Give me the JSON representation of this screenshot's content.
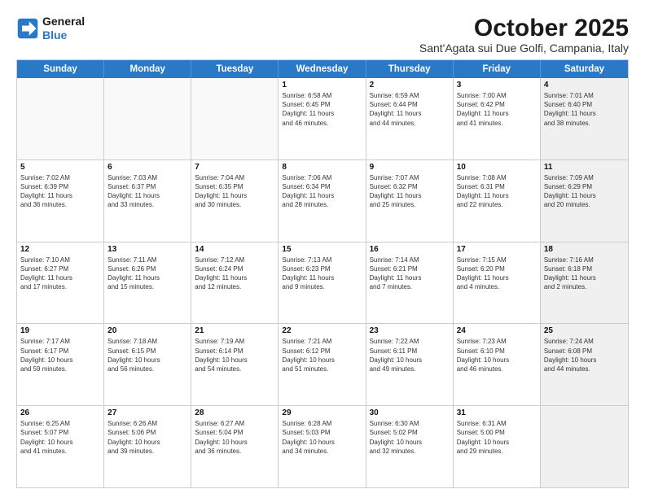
{
  "logo": {
    "line1": "General",
    "line2": "Blue"
  },
  "title": "October 2025",
  "subtitle": "Sant'Agata sui Due Golfi, Campania, Italy",
  "days": [
    "Sunday",
    "Monday",
    "Tuesday",
    "Wednesday",
    "Thursday",
    "Friday",
    "Saturday"
  ],
  "rows": [
    [
      {
        "day": "",
        "text": "",
        "empty": true
      },
      {
        "day": "",
        "text": "",
        "empty": true
      },
      {
        "day": "",
        "text": "",
        "empty": true
      },
      {
        "day": "1",
        "text": "Sunrise: 6:58 AM\nSunset: 6:45 PM\nDaylight: 11 hours\nand 46 minutes."
      },
      {
        "day": "2",
        "text": "Sunrise: 6:59 AM\nSunset: 6:44 PM\nDaylight: 11 hours\nand 44 minutes."
      },
      {
        "day": "3",
        "text": "Sunrise: 7:00 AM\nSunset: 6:42 PM\nDaylight: 11 hours\nand 41 minutes."
      },
      {
        "day": "4",
        "text": "Sunrise: 7:01 AM\nSunset: 6:40 PM\nDaylight: 11 hours\nand 38 minutes.",
        "shaded": true
      }
    ],
    [
      {
        "day": "5",
        "text": "Sunrise: 7:02 AM\nSunset: 6:39 PM\nDaylight: 11 hours\nand 36 minutes."
      },
      {
        "day": "6",
        "text": "Sunrise: 7:03 AM\nSunset: 6:37 PM\nDaylight: 11 hours\nand 33 minutes."
      },
      {
        "day": "7",
        "text": "Sunrise: 7:04 AM\nSunset: 6:35 PM\nDaylight: 11 hours\nand 30 minutes."
      },
      {
        "day": "8",
        "text": "Sunrise: 7:06 AM\nSunset: 6:34 PM\nDaylight: 11 hours\nand 28 minutes."
      },
      {
        "day": "9",
        "text": "Sunrise: 7:07 AM\nSunset: 6:32 PM\nDaylight: 11 hours\nand 25 minutes."
      },
      {
        "day": "10",
        "text": "Sunrise: 7:08 AM\nSunset: 6:31 PM\nDaylight: 11 hours\nand 22 minutes."
      },
      {
        "day": "11",
        "text": "Sunrise: 7:09 AM\nSunset: 6:29 PM\nDaylight: 11 hours\nand 20 minutes.",
        "shaded": true
      }
    ],
    [
      {
        "day": "12",
        "text": "Sunrise: 7:10 AM\nSunset: 6:27 PM\nDaylight: 11 hours\nand 17 minutes."
      },
      {
        "day": "13",
        "text": "Sunrise: 7:11 AM\nSunset: 6:26 PM\nDaylight: 11 hours\nand 15 minutes."
      },
      {
        "day": "14",
        "text": "Sunrise: 7:12 AM\nSunset: 6:24 PM\nDaylight: 11 hours\nand 12 minutes."
      },
      {
        "day": "15",
        "text": "Sunrise: 7:13 AM\nSunset: 6:23 PM\nDaylight: 11 hours\nand 9 minutes."
      },
      {
        "day": "16",
        "text": "Sunrise: 7:14 AM\nSunset: 6:21 PM\nDaylight: 11 hours\nand 7 minutes."
      },
      {
        "day": "17",
        "text": "Sunrise: 7:15 AM\nSunset: 6:20 PM\nDaylight: 11 hours\nand 4 minutes."
      },
      {
        "day": "18",
        "text": "Sunrise: 7:16 AM\nSunset: 6:18 PM\nDaylight: 11 hours\nand 2 minutes.",
        "shaded": true
      }
    ],
    [
      {
        "day": "19",
        "text": "Sunrise: 7:17 AM\nSunset: 6:17 PM\nDaylight: 10 hours\nand 59 minutes."
      },
      {
        "day": "20",
        "text": "Sunrise: 7:18 AM\nSunset: 6:15 PM\nDaylight: 10 hours\nand 56 minutes."
      },
      {
        "day": "21",
        "text": "Sunrise: 7:19 AM\nSunset: 6:14 PM\nDaylight: 10 hours\nand 54 minutes."
      },
      {
        "day": "22",
        "text": "Sunrise: 7:21 AM\nSunset: 6:12 PM\nDaylight: 10 hours\nand 51 minutes."
      },
      {
        "day": "23",
        "text": "Sunrise: 7:22 AM\nSunset: 6:11 PM\nDaylight: 10 hours\nand 49 minutes."
      },
      {
        "day": "24",
        "text": "Sunrise: 7:23 AM\nSunset: 6:10 PM\nDaylight: 10 hours\nand 46 minutes."
      },
      {
        "day": "25",
        "text": "Sunrise: 7:24 AM\nSunset: 6:08 PM\nDaylight: 10 hours\nand 44 minutes.",
        "shaded": true
      }
    ],
    [
      {
        "day": "26",
        "text": "Sunrise: 6:25 AM\nSunset: 5:07 PM\nDaylight: 10 hours\nand 41 minutes."
      },
      {
        "day": "27",
        "text": "Sunrise: 6:26 AM\nSunset: 5:06 PM\nDaylight: 10 hours\nand 39 minutes."
      },
      {
        "day": "28",
        "text": "Sunrise: 6:27 AM\nSunset: 5:04 PM\nDaylight: 10 hours\nand 36 minutes."
      },
      {
        "day": "29",
        "text": "Sunrise: 6:28 AM\nSunset: 5:03 PM\nDaylight: 10 hours\nand 34 minutes."
      },
      {
        "day": "30",
        "text": "Sunrise: 6:30 AM\nSunset: 5:02 PM\nDaylight: 10 hours\nand 32 minutes."
      },
      {
        "day": "31",
        "text": "Sunrise: 6:31 AM\nSunset: 5:00 PM\nDaylight: 10 hours\nand 29 minutes."
      },
      {
        "day": "",
        "text": "",
        "empty": true,
        "shaded": true
      }
    ]
  ]
}
